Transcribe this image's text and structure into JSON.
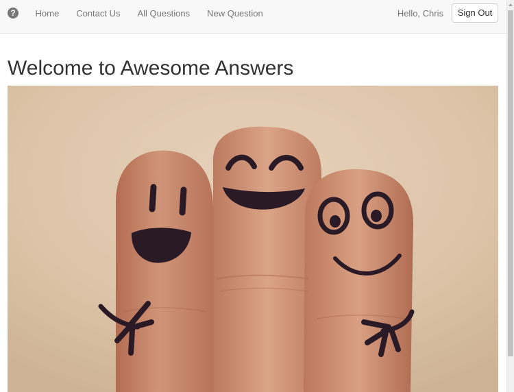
{
  "navbar": {
    "brand_icon": "question-circle-icon",
    "brand_glyph": "?",
    "links": [
      {
        "label": "Home"
      },
      {
        "label": "Contact Us"
      },
      {
        "label": "All Questions"
      },
      {
        "label": "New Question"
      }
    ],
    "greeting": "Hello, Chris",
    "sign_out_label": "Sign Out"
  },
  "main": {
    "title": "Welcome to Awesome Answers",
    "hero_image": "smiley-fingers-image"
  },
  "colors": {
    "navbar_bg": "#f8f8f8",
    "nav_text": "#777777",
    "title_text": "#333333",
    "hero_background": "#dbc3a7",
    "skin": "#c98a6c",
    "ink": "#2a1a26"
  }
}
